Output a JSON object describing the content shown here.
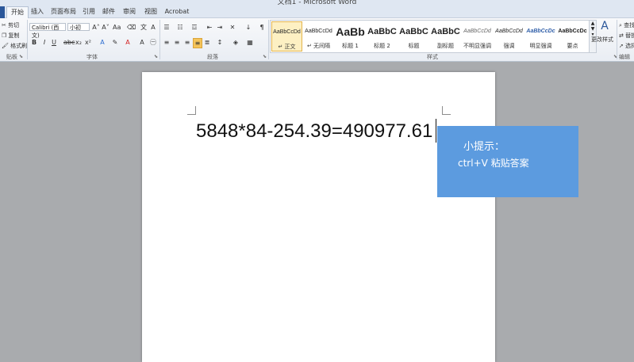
{
  "window": {
    "title": "文档1 - Microsoft Word"
  },
  "tabs": [
    {
      "label": "开始",
      "active": true
    },
    {
      "label": "插入"
    },
    {
      "label": "页面布局"
    },
    {
      "label": "引用"
    },
    {
      "label": "邮件"
    },
    {
      "label": "审阅"
    },
    {
      "label": "视图"
    },
    {
      "label": "Acrobat"
    }
  ],
  "clipboard": {
    "cut": "剪切",
    "copy": "复制",
    "format_painter": "格式刷",
    "group": "贴板"
  },
  "font": {
    "name": "Calibri (西文)",
    "size": "小初",
    "group": "字体"
  },
  "paragraph": {
    "group": "段落"
  },
  "styles": {
    "group": "样式",
    "items": [
      {
        "preview": "AaBbCcDd",
        "name": "↵ 正文",
        "selected": true
      },
      {
        "preview": "AaBbCcDd",
        "name": "↵ 无间隔"
      },
      {
        "preview": "AaBb",
        "name": "标题 1"
      },
      {
        "preview": "AaBbC",
        "name": "标题 2"
      },
      {
        "preview": "AaBbC",
        "name": "标题"
      },
      {
        "preview": "AaBbC",
        "name": "副标题"
      },
      {
        "preview": "AaBbCcDd",
        "name": "不明显强调"
      },
      {
        "preview": "AaBbCcDd",
        "name": "强调"
      },
      {
        "preview": "AaBbCcDc",
        "name": "明显强调"
      },
      {
        "preview": "AaBbCcDc",
        "name": "要点"
      }
    ],
    "change_styles": "更改样式"
  },
  "editing": {
    "find": "查找",
    "replace": "替换",
    "select": "选择",
    "group": "编辑"
  },
  "document": {
    "text": "5848*84-254.39=490977.61"
  },
  "hint": {
    "title": "小提示：",
    "body": "ctrl+V 粘贴答案"
  },
  "colors": {
    "accent": "#2b579a",
    "hint_bg": "#5c9bdf",
    "workspace": "#a9abae"
  }
}
